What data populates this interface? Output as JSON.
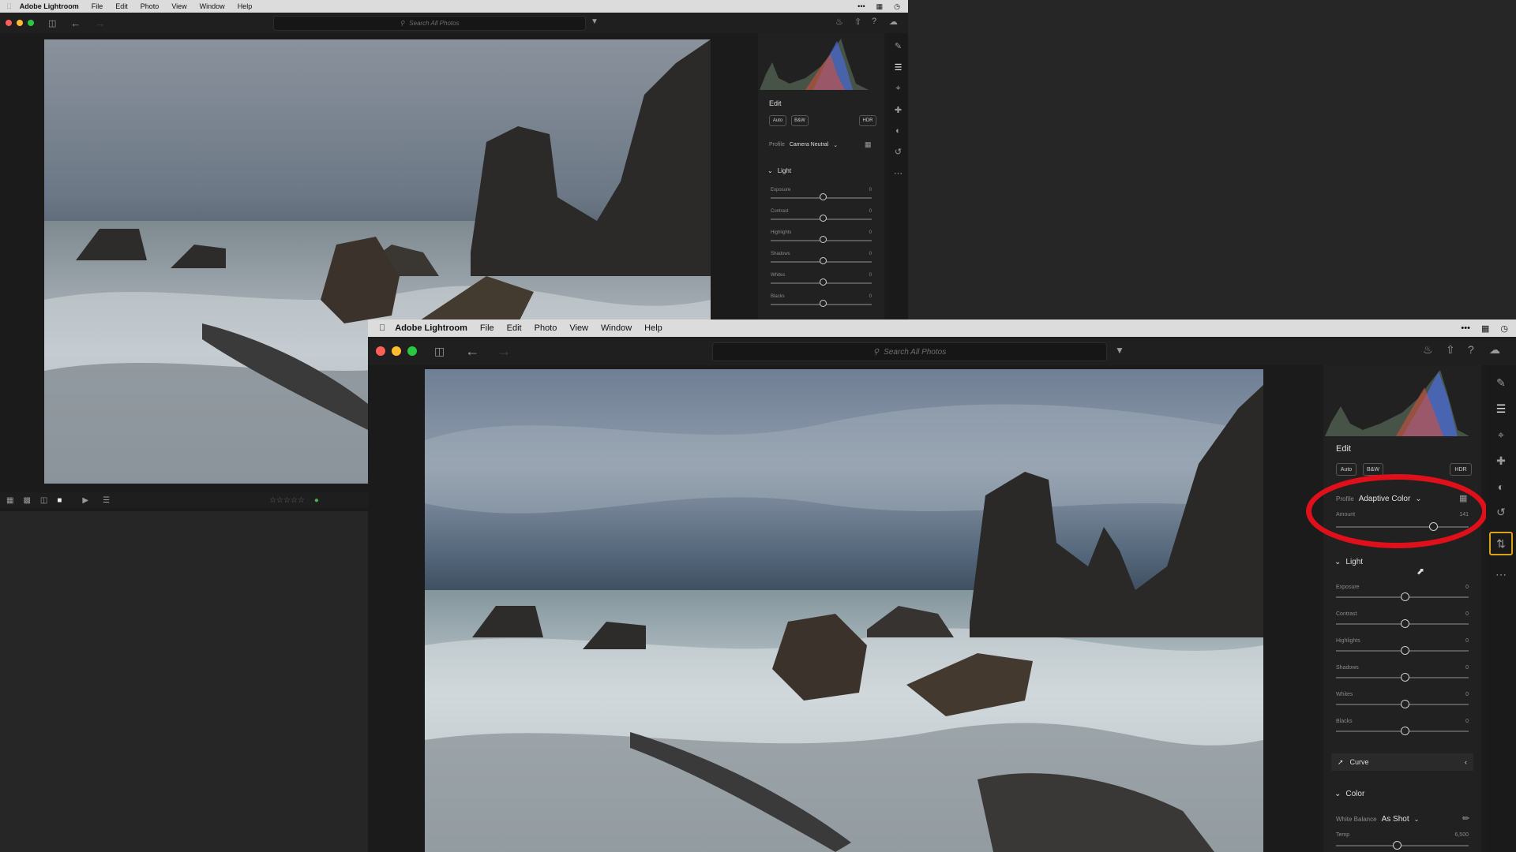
{
  "menubar": {
    "app_name": "Adobe Lightroom",
    "items": [
      "File",
      "Edit",
      "Photo",
      "View",
      "Window",
      "Help"
    ]
  },
  "search": {
    "placeholder": "Search All Photos"
  },
  "edit_panel": {
    "title": "Edit",
    "buttons": {
      "auto": "Auto",
      "bw": "B&W",
      "hdr": "HDR"
    },
    "profile_label": "Profile",
    "back_profile_value": "Camera Neutral",
    "front_profile_value": "Adaptive Color",
    "amount_label": "Amount",
    "amount_value": "141",
    "light_section": "Light",
    "light_sliders": [
      {
        "label": "Exposure",
        "value": "0"
      },
      {
        "label": "Contrast",
        "value": "0"
      },
      {
        "label": "Highlights",
        "value": "0"
      },
      {
        "label": "Shadows",
        "value": "0"
      },
      {
        "label": "Whites",
        "value": "0"
      },
      {
        "label": "Blacks",
        "value": "0"
      }
    ],
    "curve_section": "Curve",
    "color_section": "Color",
    "white_balance_label": "White Balance",
    "white_balance_value": "As Shot",
    "temp_label": "Temp",
    "temp_value": "6,500"
  },
  "colors": {
    "highlight_ring": "#e0101a",
    "active_tool_border": "#d9a21b",
    "histogram_blue": "#4a6bd6",
    "histogram_red": "#d0503a",
    "histogram_green": "#4f8f4f"
  },
  "icons": {
    "sidebar_tools": [
      "edit-icon",
      "sliders-icon",
      "crop-icon",
      "healing-icon",
      "masking-icon",
      "versions-icon",
      "presets-icon",
      "more-icon"
    ],
    "toolbar": [
      "panel-toggle-icon",
      "back-arrow-icon",
      "forward-arrow-icon",
      "filter-icon",
      "bell-icon",
      "share-icon",
      "help-icon",
      "cloud-icon"
    ]
  }
}
